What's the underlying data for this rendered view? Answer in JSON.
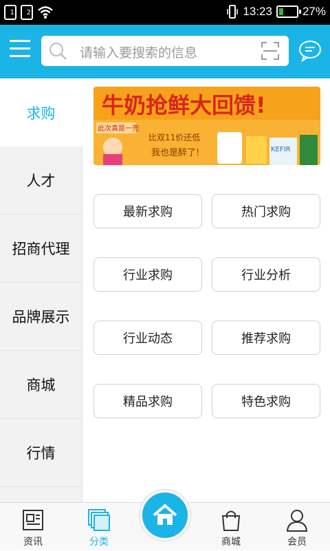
{
  "status_bar": {
    "sim1": "1",
    "sim2": "2",
    "time": "13:23",
    "battery_percent": "27%",
    "battery_level": 0.27
  },
  "header": {
    "search_placeholder": "请输入要搜索的信息"
  },
  "sidebar": {
    "items": [
      {
        "label": "求购",
        "active": true
      },
      {
        "label": "人才"
      },
      {
        "label": "招商代理"
      },
      {
        "label": "品牌展示"
      },
      {
        "label": "商城"
      },
      {
        "label": "行情"
      }
    ]
  },
  "banner": {
    "headline": "牛奶抢鲜大回馈!",
    "sub1": "比双11价还低",
    "sub2": "我也是醉了!",
    "badge": "此次真是一壳",
    "product_text": "KEFIR"
  },
  "buttons": [
    "最新求购",
    "热门求购",
    "行业求购",
    "行业分析",
    "行业动态",
    "推荐求购",
    "精品求购",
    "特色求购"
  ],
  "tabbar": {
    "tabs": [
      {
        "label": "资讯",
        "icon": "newspaper-icon"
      },
      {
        "label": "分类",
        "icon": "category-icon",
        "active": true
      },
      {
        "label": "",
        "icon": "home-icon"
      },
      {
        "label": "商城",
        "icon": "shopping-bag-icon"
      },
      {
        "label": "会员",
        "icon": "person-icon"
      }
    ]
  },
  "colors": {
    "accent": "#1bb4e6",
    "banner_bg": "#f9b233",
    "banner_red": "#d9261c"
  }
}
